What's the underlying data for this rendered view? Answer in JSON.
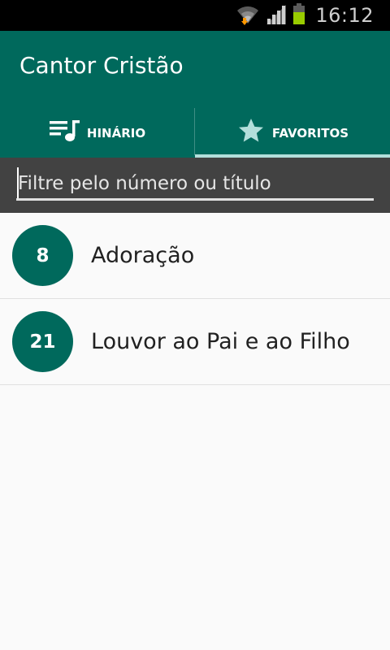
{
  "status_bar": {
    "time": "16:12",
    "icons": [
      "wifi-icon",
      "signal-icon",
      "battery-icon"
    ],
    "battery_color": "#99cc00"
  },
  "app_bar": {
    "title": "Cantor Cristão",
    "color": "#00695c"
  },
  "tabs": [
    {
      "label": "HINÁRIO",
      "icon": "music-list-icon",
      "selected": false
    },
    {
      "label": "FAVORITOS",
      "icon": "star-icon",
      "selected": true
    }
  ],
  "filter": {
    "placeholder": "Filtre pelo número ou título",
    "value": ""
  },
  "favorites": [
    {
      "number": "8",
      "title": "Adoração"
    },
    {
      "number": "21",
      "title": "Louvor ao Pai e ao Filho"
    }
  ]
}
